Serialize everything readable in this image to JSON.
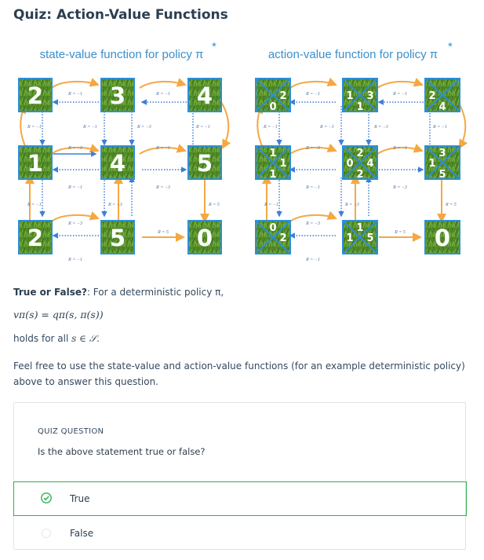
{
  "page": {
    "title": "Quiz: Action-Value Functions"
  },
  "figure": {
    "left_title": "state-value function for policy π",
    "right_title": "action-value function for policy π",
    "star": "*",
    "state_values": [
      "2",
      "3",
      "4",
      "1",
      "4",
      "5",
      "2",
      "5",
      "0"
    ],
    "action_values": {
      "c00": {
        "top": "",
        "right": "2",
        "bottom": "0",
        "left": ""
      },
      "c01": {
        "top": "",
        "right": "3",
        "bottom": "1",
        "left": "1"
      },
      "c02": {
        "top": "",
        "right": "",
        "bottom": "4",
        "left": "2"
      },
      "c10": {
        "top": "1",
        "right": "1",
        "bottom": "1",
        "left": ""
      },
      "c11": {
        "top": "2",
        "right": "4",
        "bottom": "2",
        "left": "0"
      },
      "c12": {
        "top": "3",
        "right": "",
        "bottom": "5",
        "left": "1"
      },
      "c20": {
        "top": "0",
        "right": "2",
        "bottom": "",
        "left": ""
      },
      "c21": {
        "top": "1",
        "right": "5",
        "bottom": "",
        "left": "1"
      },
      "c22": {
        "value": "0"
      }
    },
    "reward_labels": {
      "m1": "R = −1",
      "m3": "R = −3",
      "p5": "R = 5"
    }
  },
  "question": {
    "lead_bold": "True or False?",
    "lead_text": ": For a deterministic policy π,",
    "equation": "vπ(s) = qπ(s, π(s))",
    "holds_text": "holds for all",
    "holds_math": "s ∈ 𝒮.",
    "feel_free": "Feel free to use the state-value and action-value functions (for an example deterministic policy) above to answer this question."
  },
  "quiz": {
    "header": "QUIZ QUESTION",
    "prompt": "Is the above statement true or false?",
    "options": [
      {
        "label": "True",
        "selected": true
      },
      {
        "label": "False",
        "selected": false
      }
    ]
  },
  "colors": {
    "accent_green": "#2eb14e",
    "title_blue": "#3b8fcb",
    "tile_border": "#2d8fd5",
    "orange_arrow": "#f5a742",
    "blue_dotted": "#3f7fd6"
  }
}
